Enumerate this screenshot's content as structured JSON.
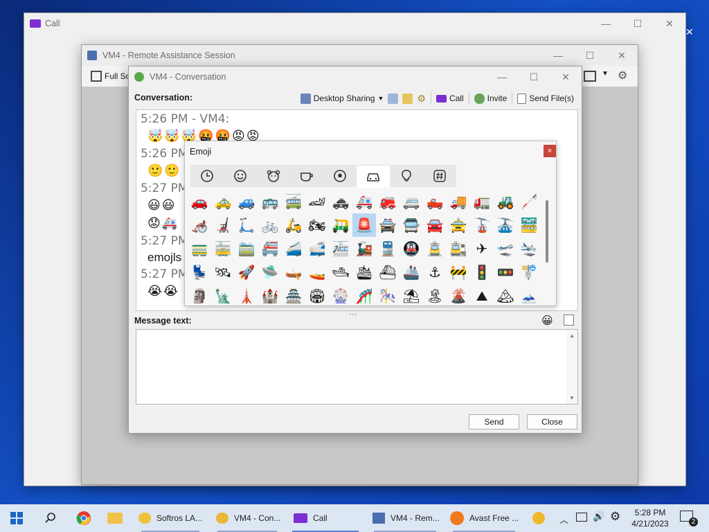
{
  "call_window": {
    "title": "Call"
  },
  "ra_window": {
    "title": "VM4 - Remote Assistance Session",
    "full_screen_label": "Full Sc"
  },
  "conv_window": {
    "title": "VM4 - Conversation",
    "conversation_label": "Conversation:",
    "toolbar": {
      "desktop_sharing": "Desktop Sharing",
      "call": "Call",
      "invite": "Invite",
      "send_files": "Send File(s)"
    },
    "log": [
      {
        "time": "5:26 PM - VM4:",
        "emojis": "🤯🤯🤯🤬🤬😡😡"
      },
      {
        "time": "5:26 PM",
        "emojis": "🙂🙂"
      },
      {
        "time": "5:27 PM",
        "emojis": "😃😃"
      },
      {
        "time": "",
        "emojis": "😟🚑"
      },
      {
        "time": "5:27 PM",
        "text": "emojls"
      },
      {
        "time": "5:27 PM",
        "emojis": "😭😭"
      }
    ],
    "message_label": "Message text:",
    "message_value": "",
    "send_label": "Send",
    "close_label": "Close"
  },
  "emoji_panel": {
    "title": "Emoji",
    "close": "×",
    "tabs": [
      "clock-icon",
      "smiley-icon",
      "animal-icon",
      "food-icon",
      "activity-icon",
      "car-icon",
      "lightbulb-icon",
      "symbols-icon"
    ],
    "active_tab": 5,
    "rows": [
      [
        "🚗",
        "🚕",
        "🚙",
        "🚌",
        "🚎",
        "🏎",
        "🚓",
        "🚑",
        "🚒",
        "🚐",
        "🛻",
        "🚚",
        "🚛",
        "🚜",
        "🦯"
      ],
      [
        "🦽",
        "🦼",
        "🛴",
        "🚲",
        "🛵",
        "🏍",
        "🛺",
        "🚨",
        "🚔",
        "🚍",
        "🚘",
        "🚖",
        "🚡",
        "🚠",
        "🚟"
      ],
      [
        "🚃",
        "🚋",
        "🚞",
        "🚝",
        "🚄",
        "🚅",
        "🚈",
        "🚂",
        "🚆",
        "🚇",
        "🚊",
        "🚉",
        "✈",
        "🛫",
        "🛬"
      ],
      [
        "💺",
        "🛰",
        "🚀",
        "🛸",
        "🛶",
        "🚤",
        "🛥",
        "🛳",
        "⛴",
        "🚢",
        "⚓",
        "🚧",
        "🚦",
        "🚥",
        "🚏"
      ],
      [
        "🗿",
        "🗽",
        "🗼",
        "🏰",
        "🏯",
        "🏟",
        "🎡",
        "🎢",
        "🎠",
        "⛱",
        "🏝",
        "🌋",
        "⛰",
        "🏔",
        "🗻"
      ]
    ],
    "selected": "🚨"
  },
  "taskbar": {
    "items": [
      {
        "label": "Softros LA..."
      },
      {
        "label": "VM4 - Con..."
      },
      {
        "label": "Call"
      },
      {
        "label": "VM4 - Rem..."
      },
      {
        "label": "Avast Free ..."
      }
    ],
    "time": "5:28 PM",
    "date": "4/21/2023",
    "notifications": "2"
  }
}
